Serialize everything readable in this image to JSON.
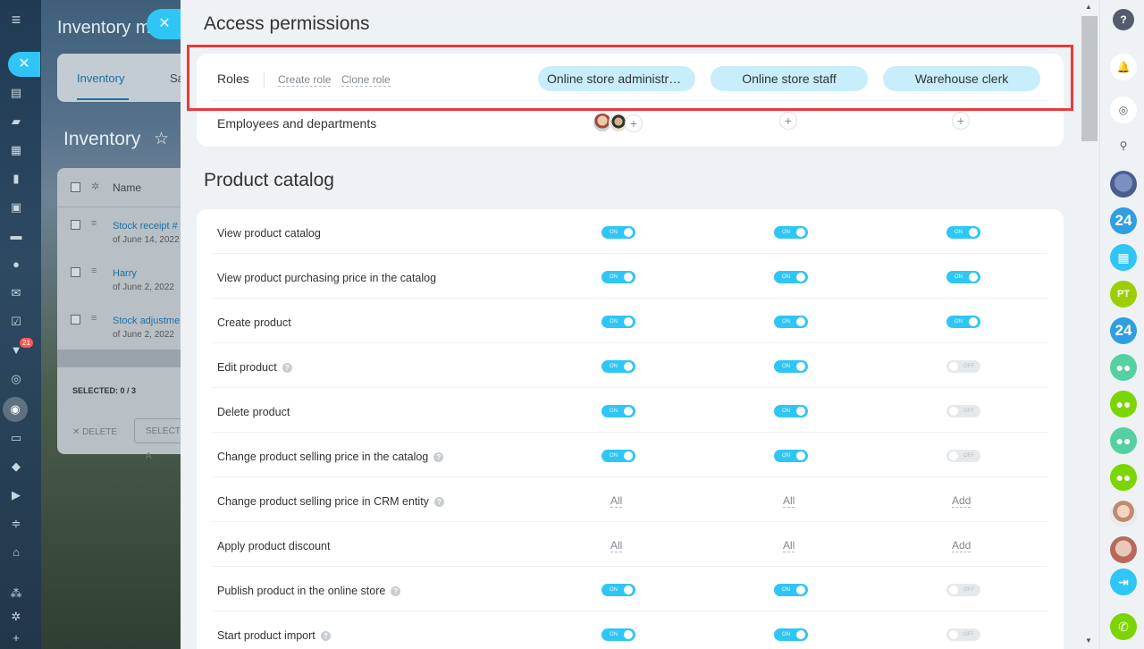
{
  "background": {
    "page_title": "Inventory m",
    "tabs": [
      "Inventory",
      "Sa"
    ],
    "heading": "Inventory",
    "grid_header": "Name",
    "rows": [
      {
        "name": "Stock receipt #",
        "date": "of June 14, 2022"
      },
      {
        "name": "Harry",
        "date": "of June 2, 2022"
      },
      {
        "name": "Stock adjustme",
        "date": "of June 2, 2022"
      }
    ],
    "selected": "SELECTED: 0 / 3",
    "delete_label": "DELETE",
    "select_label": "SELECT A",
    "nav_badge": "21"
  },
  "panel": {
    "title": "Access permissions",
    "roles_label": "Roles",
    "create_role": "Create role",
    "clone_role": "Clone role",
    "roles": [
      "Online store administrat...",
      "Online store staff",
      "Warehouse clerk"
    ],
    "employees_label": "Employees and departments",
    "section_title": "Product catalog",
    "rows": [
      {
        "label": "View product catalog",
        "help": false,
        "cells": [
          "on",
          "on",
          "on"
        ]
      },
      {
        "label": "View product purchasing price in the catalog",
        "help": false,
        "cells": [
          "on",
          "on",
          "on"
        ]
      },
      {
        "label": "Create product",
        "help": false,
        "cells": [
          "on",
          "on",
          "on"
        ]
      },
      {
        "label": "Edit product",
        "help": true,
        "cells": [
          "on",
          "on",
          "off"
        ]
      },
      {
        "label": "Delete product",
        "help": false,
        "cells": [
          "on",
          "on",
          "off"
        ]
      },
      {
        "label": "Change product selling price in the catalog",
        "help": true,
        "cells": [
          "on",
          "on",
          "off"
        ]
      },
      {
        "label": "Change product selling price in CRM entity",
        "help": true,
        "cells": [
          "All",
          "All",
          "Add"
        ]
      },
      {
        "label": "Apply product discount",
        "help": false,
        "cells": [
          "All",
          "All",
          "Add"
        ]
      },
      {
        "label": "Publish product in the online store",
        "help": true,
        "cells": [
          "on",
          "on",
          "off"
        ]
      },
      {
        "label": "Start product import",
        "help": true,
        "cells": [
          "on",
          "on",
          "off"
        ]
      }
    ],
    "toggle_on_text": "ON",
    "toggle_off_text": "OFF"
  },
  "right_sidebar": {
    "items": [
      "?",
      "bell",
      "chat",
      "search",
      "photo",
      "24",
      "calendar",
      "PT",
      "24",
      "group",
      "group",
      "group",
      "group",
      "photo",
      "photo",
      "door",
      "phone"
    ]
  },
  "colors": {
    "accent": "#2fc6f6",
    "role_pill": "#c8edfb",
    "highlight_frame": "#e83b3b"
  }
}
